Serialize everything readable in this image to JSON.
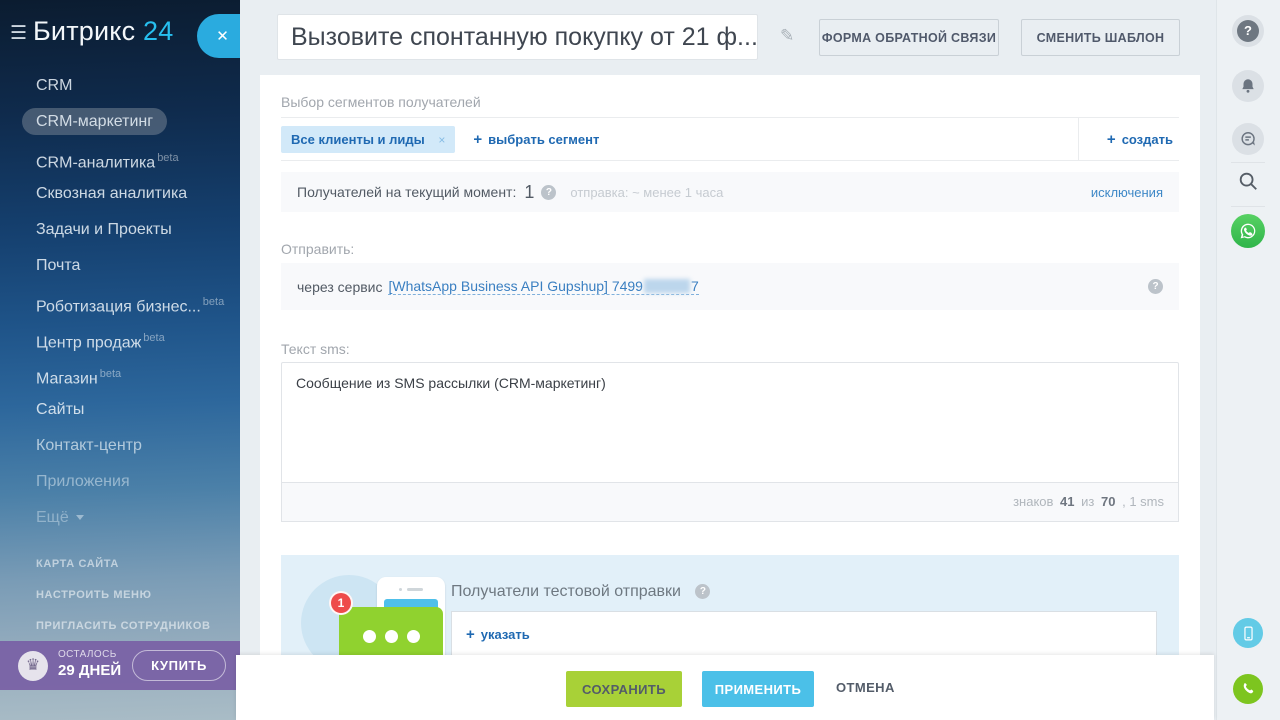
{
  "sidebar": {
    "logo": {
      "brand": "Битрикс",
      "suffix": "24"
    },
    "items": [
      {
        "label": "CRM"
      },
      {
        "label": "CRM-маркетинг"
      },
      {
        "label": "CRM-аналитика",
        "beta": "beta"
      },
      {
        "label": "Сквозная аналитика"
      },
      {
        "label": "Задачи и Проекты"
      },
      {
        "label": "Почта"
      },
      {
        "label": "Роботизация бизнес...",
        "beta": "beta"
      },
      {
        "label": "Центр продаж",
        "beta": "beta"
      },
      {
        "label": "Магазин",
        "beta": "beta"
      },
      {
        "label": "Сайты"
      },
      {
        "label": "Контакт-центр"
      },
      {
        "label": "Приложения"
      },
      {
        "label": "Ещё"
      }
    ],
    "caps_links": {
      "sitemap": "КАРТА САЙТА",
      "configure_menu": "НАСТРОИТЬ МЕНЮ",
      "invite": "ПРИГЛАСИТЬ СОТРУДНИКОВ"
    },
    "license": {
      "remaining_label": "ОСТАЛОСЬ",
      "remaining_value": "29 ДНЕЙ",
      "buy_label": "КУПИТЬ"
    }
  },
  "header": {
    "title": "Вызовите спонтанную покупку от 21 ф...",
    "feedback_button": "ФОРМА ОБРАТНОЙ СВЯЗИ",
    "change_template_button": "СМЕНИТЬ ШАБЛОН"
  },
  "main": {
    "segments": {
      "label": "Выбор сегментов получателей",
      "chip": "Все клиенты и лиды",
      "select_link": "выбрать сегмент",
      "create_link": "создать"
    },
    "recipients": {
      "label": "Получателей на текущий момент:",
      "count": "1",
      "estimate": "отправка: ~ менее 1 часа",
      "exclusions_link": "исключения"
    },
    "send": {
      "label": "Отправить:",
      "prefix": "через сервис",
      "service_link_prefix": "[WhatsApp Business API Gupshup] 7499",
      "service_link_suffix": "7"
    },
    "sms": {
      "label": "Текст sms:",
      "text": "Сообщение из SMS рассылки (CRM-маркетинг)",
      "counter": {
        "prefix": "знаков",
        "chars": "41",
        "of": "из",
        "max": "70",
        "suffix": ", 1 sms"
      }
    },
    "test": {
      "label": "Получатели тестовой отправки",
      "badge": "1",
      "add_link": "указать"
    }
  },
  "footer": {
    "save": "СОХРАНИТЬ",
    "apply": "ПРИМЕНИТЬ",
    "cancel": "ОТМЕНА"
  },
  "icons": {
    "hamburger": "☰",
    "close": "✕",
    "pencil": "✎",
    "chip_remove": "×",
    "plus": "+",
    "help": "?",
    "crown": "♛",
    "badge_one": "1"
  },
  "colors": {
    "link_blue": "#1f69b2",
    "chip_bg": "#d2e9f9",
    "save_green": "#a8d137",
    "apply_blue": "#4bc0e8",
    "license_purple": "#785fa5",
    "test_panel_blue": "#e2f0f9",
    "whatsapp_green": "#3fc351",
    "close_button_blue": "#2aabdf"
  }
}
